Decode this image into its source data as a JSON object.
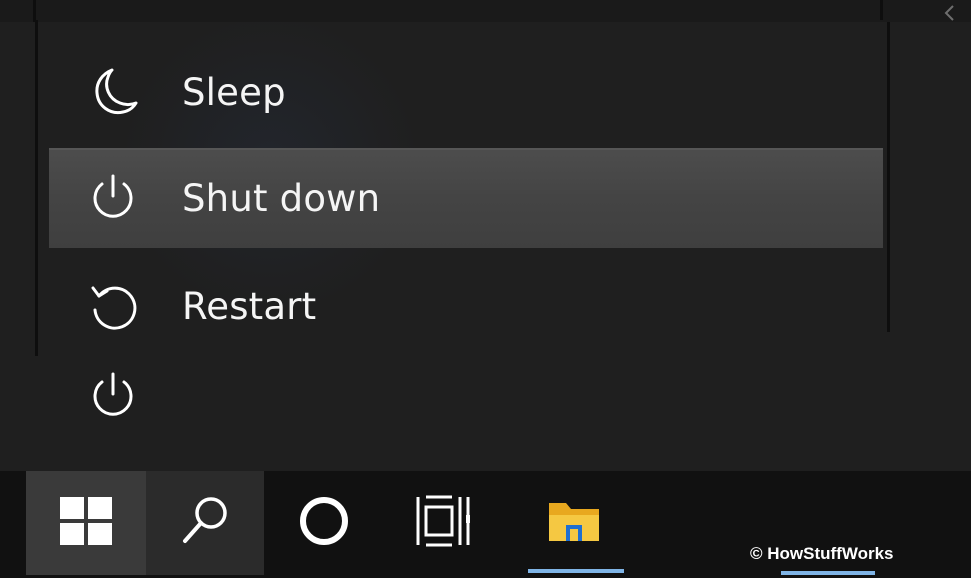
{
  "power_menu": {
    "items": [
      {
        "label": "Sleep",
        "icon": "moon-icon"
      },
      {
        "label": "Shut down",
        "icon": "power-icon"
      },
      {
        "label": "Restart",
        "icon": "restart-icon"
      }
    ],
    "highlighted_item": "Shut down",
    "power_button_icon": "power-icon"
  },
  "taskbar": {
    "items": [
      {
        "name": "start",
        "icon": "windows-logo-icon"
      },
      {
        "name": "search",
        "icon": "search-icon"
      },
      {
        "name": "cortana",
        "icon": "cortana-ring-icon"
      },
      {
        "name": "task-view",
        "icon": "task-view-icon"
      },
      {
        "name": "file-explorer",
        "icon": "folder-icon"
      }
    ],
    "accent_color": "#7fb4e6",
    "folder_color": "#f2c037"
  },
  "watermark": {
    "text": "© HowStuffWorks"
  }
}
